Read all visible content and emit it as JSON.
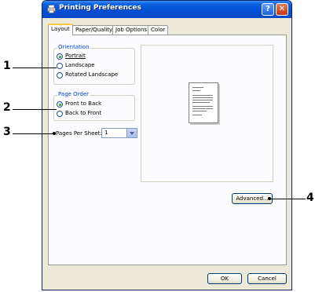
{
  "window": {
    "title": "Printing Preferences",
    "help_glyph": "?",
    "close_glyph": "✕"
  },
  "tabs": [
    {
      "label": "Layout",
      "active": true
    },
    {
      "label": "Paper/Quality",
      "active": false
    },
    {
      "label": "Job Options",
      "active": false
    },
    {
      "label": "Color",
      "active": false
    }
  ],
  "orientation": {
    "label": "Orientation",
    "options": [
      {
        "label": "Portrait",
        "checked": true
      },
      {
        "label": "Landscape",
        "checked": false
      },
      {
        "label": "Rotated Landscape",
        "checked": false
      }
    ]
  },
  "page_order": {
    "label": "Page Order",
    "options": [
      {
        "label": "Front to Back",
        "checked": true
      },
      {
        "label": "Back to Front",
        "checked": false
      }
    ]
  },
  "pages_per_sheet": {
    "label": "Pages Per Sheet:",
    "value": "1"
  },
  "buttons": {
    "advanced": "Advanced...",
    "ok": "OK",
    "cancel": "Cancel"
  },
  "callouts": [
    "1",
    "2",
    "3",
    "4"
  ],
  "colors": {
    "titlebar": "#0450d6",
    "group_label": "#0046d5",
    "window_bg": "#ece9d8"
  }
}
